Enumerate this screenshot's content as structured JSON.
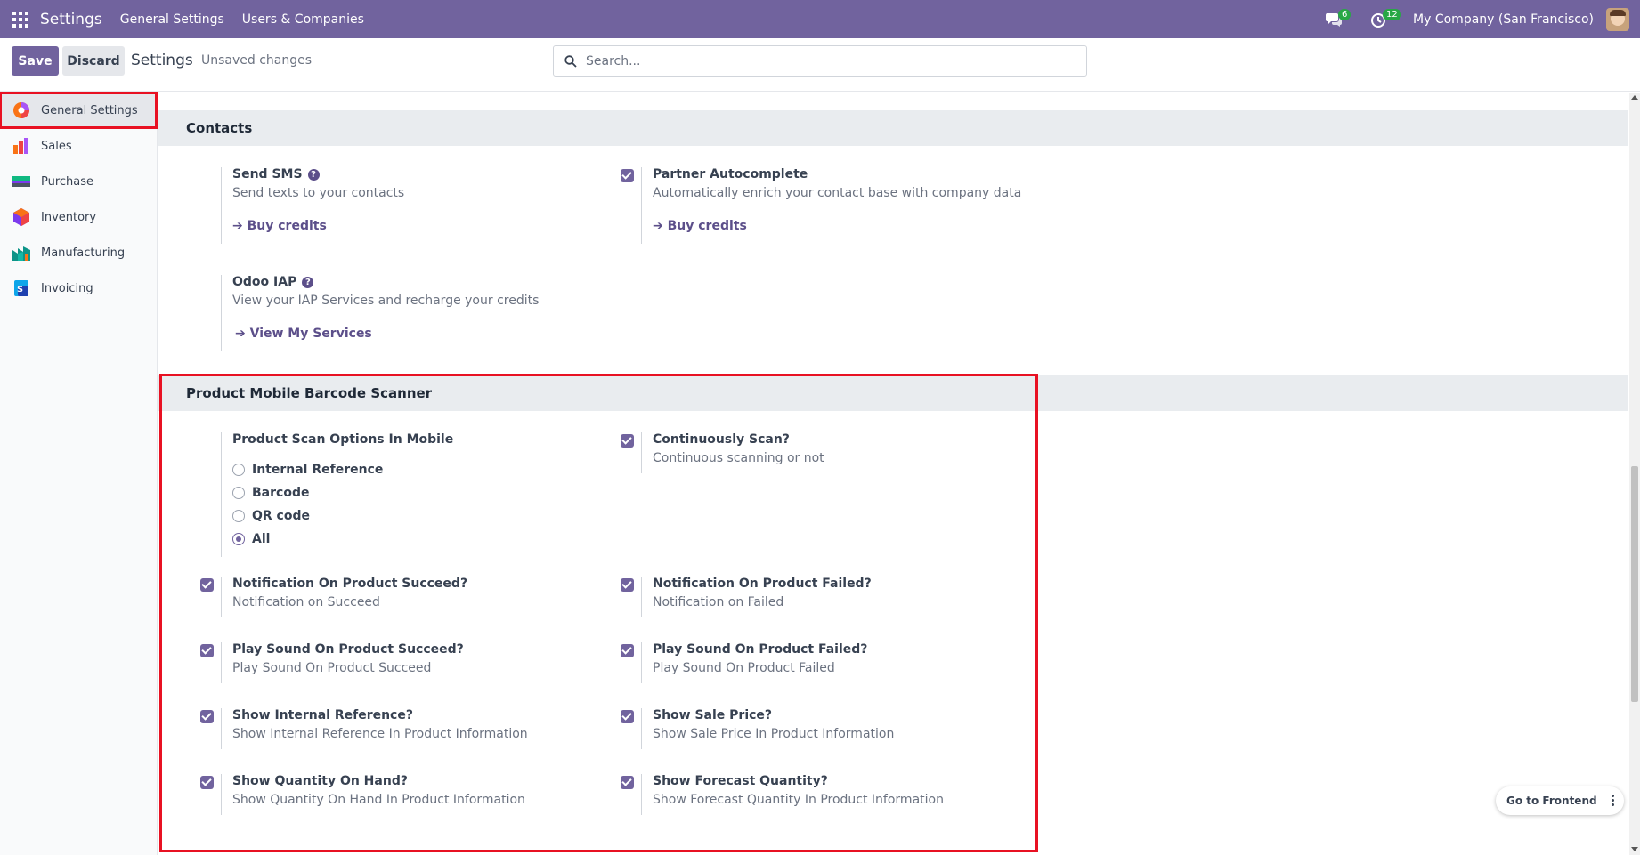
{
  "topbar": {
    "brand": "Settings",
    "menu": [
      "General Settings",
      "Users & Companies"
    ],
    "messages_count": "6",
    "activities_count": "12",
    "company": "My Company (San Francisco)"
  },
  "control": {
    "save_label": "Save",
    "discard_label": "Discard",
    "title": "Settings",
    "status": "Unsaved changes",
    "search_placeholder": "Search..."
  },
  "sidebar": {
    "items": [
      {
        "label": "General Settings",
        "icon": "general-settings-icon"
      },
      {
        "label": "Sales",
        "icon": "sales-icon"
      },
      {
        "label": "Purchase",
        "icon": "purchase-icon"
      },
      {
        "label": "Inventory",
        "icon": "inventory-icon"
      },
      {
        "label": "Manufacturing",
        "icon": "manufacturing-icon"
      },
      {
        "label": "Invoicing",
        "icon": "invoicing-icon"
      }
    ]
  },
  "contacts": {
    "heading": "Contacts",
    "send_sms": {
      "title": "Send SMS",
      "desc": "Send texts to your contacts",
      "link": "Buy credits"
    },
    "partner_autocomplete": {
      "title": "Partner Autocomplete",
      "desc": "Automatically enrich your contact base with company data",
      "link": "Buy credits",
      "checked": true
    },
    "odoo_iap": {
      "title": "Odoo IAP",
      "desc": "View your IAP Services and recharge your credits",
      "link": "View My Services"
    }
  },
  "barcode": {
    "heading": "Product Mobile Barcode Scanner",
    "scan_options": {
      "title": "Product Scan Options In Mobile",
      "options": [
        "Internal Reference",
        "Barcode",
        "QR code",
        "All"
      ],
      "selected": "All"
    },
    "continuous": {
      "title": "Continuously Scan?",
      "desc": "Continuous scanning or not",
      "checked": true
    },
    "notif_succeed": {
      "title": "Notification On Product Succeed?",
      "desc": "Notification on Succeed",
      "checked": true
    },
    "notif_failed": {
      "title": "Notification On Product Failed?",
      "desc": "Notification on Failed",
      "checked": true
    },
    "sound_succeed": {
      "title": "Play Sound On Product Succeed?",
      "desc": "Play Sound On Product Succeed",
      "checked": true
    },
    "sound_failed": {
      "title": "Play Sound On Product Failed?",
      "desc": "Play Sound On Product Failed",
      "checked": true
    },
    "show_internal_ref": {
      "title": "Show Internal Reference?",
      "desc": "Show Internal Reference In Product Information",
      "checked": true
    },
    "show_sale_price": {
      "title": "Show Sale Price?",
      "desc": "Show Sale Price In Product Information",
      "checked": true
    },
    "show_qty_on_hand": {
      "title": "Show Quantity On Hand?",
      "desc": "Show Quantity On Hand In Product Information",
      "checked": true
    },
    "show_forecast_qty": {
      "title": "Show Forecast Quantity?",
      "desc": "Show Forecast Quantity In Product Information",
      "checked": true
    }
  },
  "frontend_button": "Go to Frontend",
  "colors": {
    "brand": "#71639e",
    "highlight": "#e81123",
    "badge": "#28a745"
  }
}
